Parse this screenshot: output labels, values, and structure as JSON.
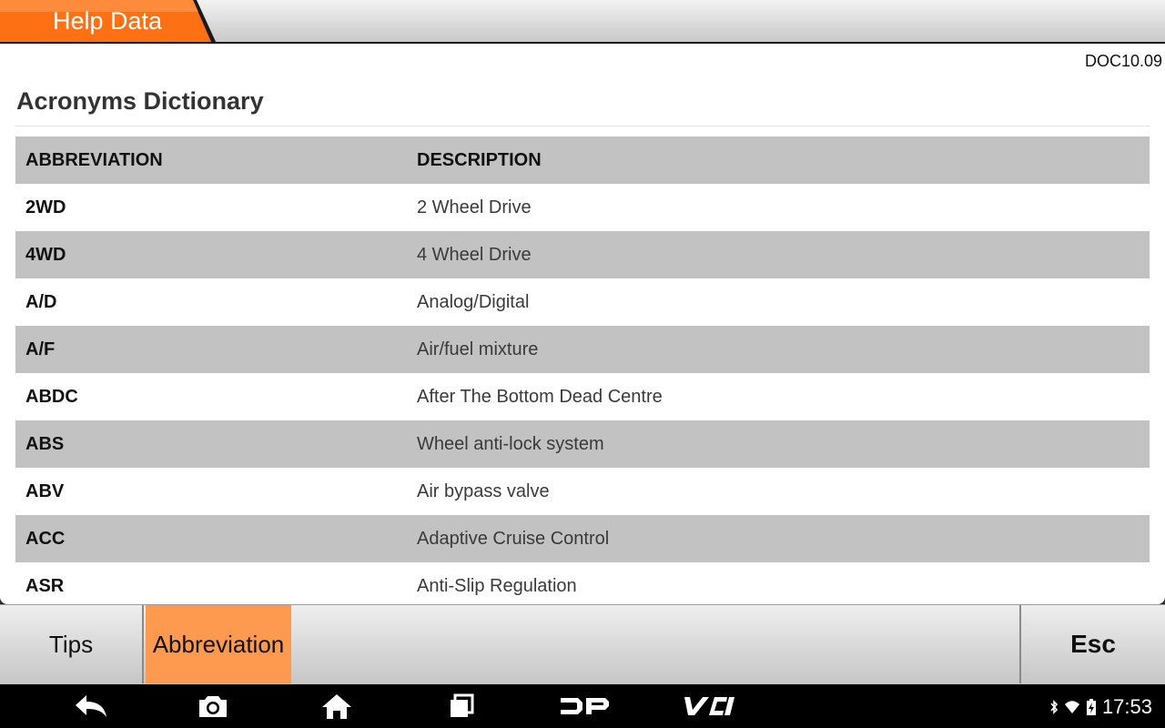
{
  "header": {
    "title": "Help Data",
    "accent": "#fd7114"
  },
  "doc_id": "DOC10.09",
  "page_title": "Acronyms Dictionary",
  "table": {
    "columns": [
      "ABBREVIATION",
      "DESCRIPTION"
    ],
    "rows": [
      {
        "abbr": "2WD",
        "desc": "2 Wheel Drive"
      },
      {
        "abbr": "4WD",
        "desc": "4 Wheel Drive"
      },
      {
        "abbr": "A/D",
        "desc": "Analog/Digital"
      },
      {
        "abbr": "A/F",
        "desc": "Air/fuel mixture"
      },
      {
        "abbr": "ABDC",
        "desc": "After The Bottom Dead Centre"
      },
      {
        "abbr": "ABS",
        "desc": "Wheel anti-lock system"
      },
      {
        "abbr": "ABV",
        "desc": "Air bypass valve"
      },
      {
        "abbr": "ACC",
        "desc": "Adaptive Cruise Control"
      },
      {
        "abbr": "ASR",
        "desc": "Anti-Slip Regulation"
      }
    ]
  },
  "toolbar": {
    "tips_label": "Tips",
    "abbreviation_label": "Abbreviation",
    "esc_label": "Esc",
    "active_color": "#fd9a50"
  },
  "navbar": {
    "icons": [
      "back-icon",
      "camera-icon",
      "home-icon",
      "recent-apps-icon",
      "dp-logo-icon",
      "vci-logo-icon"
    ],
    "dp_label": "DP",
    "vci_label": "VCI",
    "status_icons": [
      "bluetooth-icon",
      "wifi-icon",
      "battery-icon"
    ],
    "time": "17:53"
  }
}
